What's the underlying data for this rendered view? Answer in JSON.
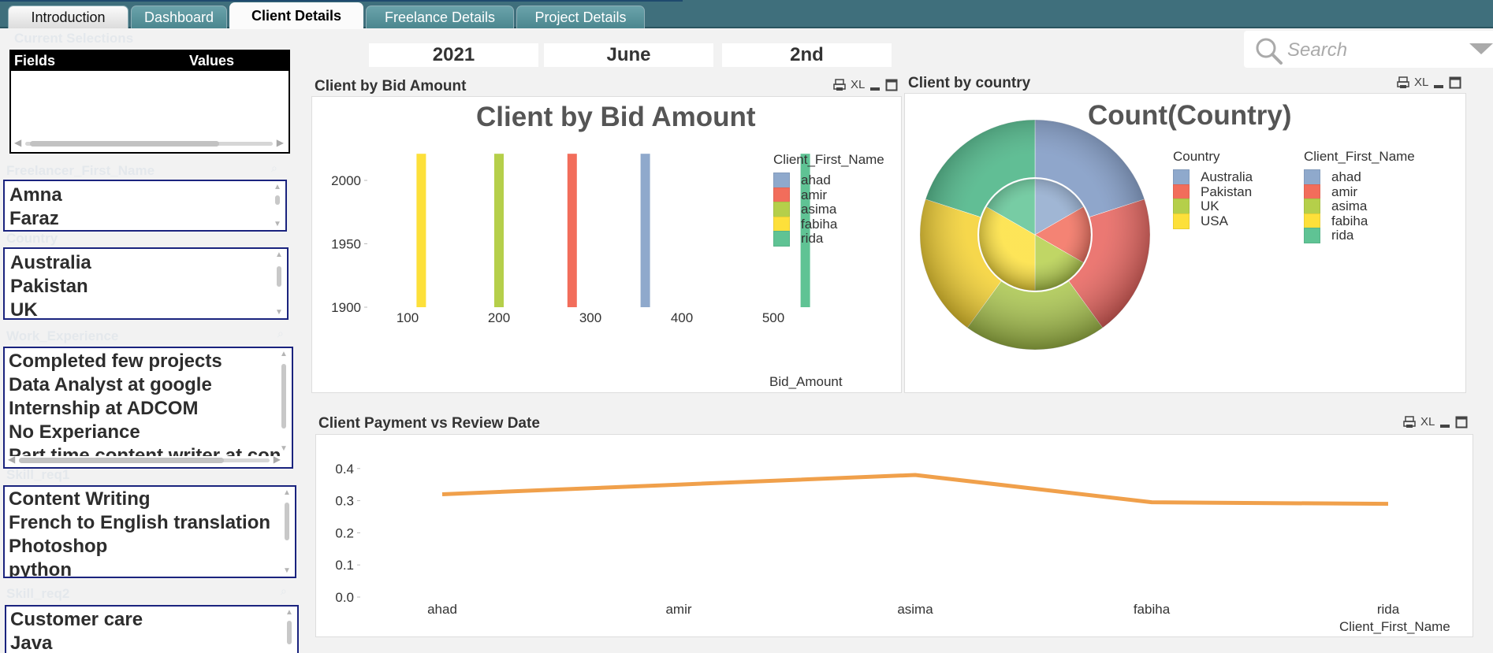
{
  "tabs": [
    {
      "label": "Introduction",
      "state": "plain"
    },
    {
      "label": "Dashboard",
      "state": "teal"
    },
    {
      "label": "Client Details",
      "state": "active"
    },
    {
      "label": "Freelance Details",
      "state": "teal"
    },
    {
      "label": "Project Details",
      "state": "teal"
    }
  ],
  "current_selections": {
    "caption": "Current Selections",
    "col_fields": "Fields",
    "col_values": "Values"
  },
  "listboxes": [
    {
      "caption": "Freelancer_First_Name",
      "items": [
        "Amna",
        "Faraz"
      ]
    },
    {
      "caption": "Country",
      "items": [
        "Australia",
        "Pakistan",
        "UK"
      ]
    },
    {
      "caption": "Work_Experience",
      "items": [
        "Completed few projects",
        "Data Analyst at google",
        "Internship at ADCOM",
        "No Experiance",
        "Part time content writer at con"
      ]
    },
    {
      "caption": "Skill_req1",
      "items": [
        "Content Writing",
        "French to English translation",
        "Photoshop",
        "python"
      ]
    },
    {
      "caption": "Skill_req2",
      "items": [
        "Customer care",
        "Java"
      ]
    }
  ],
  "date_filters": {
    "year": "2021",
    "month": "June",
    "day": "2nd"
  },
  "search": {
    "placeholder": "Search"
  },
  "bid_chart": {
    "panel_title": "Client by Bid Amount",
    "tools": {
      "xl": "XL"
    },
    "chart_data": {
      "type": "bar",
      "title": "Client by Bid Amount",
      "xlabel": "Bid_Amount",
      "ylabel": "",
      "xticks": [
        100,
        200,
        300,
        400,
        500
      ],
      "yticks": [
        1900,
        1950,
        2000
      ],
      "legend_title": "Client_First_Name",
      "legend_position": "right",
      "series": [
        {
          "name": "ahad",
          "x": 360,
          "y": 2021,
          "color": "#8fa9cc"
        },
        {
          "name": "amir",
          "x": 280,
          "y": 2021,
          "color": "#f26d5b"
        },
        {
          "name": "asima",
          "x": 200,
          "y": 2021,
          "color": "#b5cf4a"
        },
        {
          "name": "fabiha",
          "x": 115,
          "y": 2021,
          "color": "#fde03a"
        },
        {
          "name": "rida",
          "x": 535,
          "y": 2021,
          "color": "#5fc394"
        }
      ]
    }
  },
  "country_chart": {
    "panel_title": "Client by country",
    "tools": {
      "xl": "XL"
    },
    "chart_data": {
      "type": "pie",
      "title": "Count(Country)",
      "outer_legend_title": "Country",
      "inner_legend_title": "Client_First_Name",
      "outer": [
        {
          "label": "Australia",
          "value": 1,
          "color": "#7b96c2"
        },
        {
          "label": "Pakistan",
          "value": 1,
          "color": "#e8605a"
        },
        {
          "label": "UK",
          "value": 1,
          "color": "#a8c44a"
        },
        {
          "label": "USA",
          "value": 1,
          "color": "#f4d02c"
        },
        {
          "label": "",
          "value": 1,
          "color": "#45b282"
        }
      ],
      "inner": [
        {
          "label": "ahad",
          "value": 1,
          "color": "#8fa9cc"
        },
        {
          "label": "amir",
          "value": 1,
          "color": "#f26d5b"
        },
        {
          "label": "asima",
          "value": 1,
          "color": "#b5cf4a"
        },
        {
          "label": "fabiha",
          "value": 2,
          "color": "#fde03a"
        },
        {
          "label": "rida",
          "value": 1,
          "color": "#5fc394"
        }
      ],
      "legend_countries": [
        {
          "label": "Australia",
          "color": "#8fa9cc"
        },
        {
          "label": "Pakistan",
          "color": "#f26d5b"
        },
        {
          "label": "UK",
          "color": "#b5cf4a"
        },
        {
          "label": "USA",
          "color": "#fde03a"
        }
      ],
      "legend_names": [
        {
          "label": "ahad",
          "color": "#8fa9cc"
        },
        {
          "label": "amir",
          "color": "#f26d5b"
        },
        {
          "label": "asima",
          "color": "#b5cf4a"
        },
        {
          "label": "fabiha",
          "color": "#fde03a"
        },
        {
          "label": "rida",
          "color": "#5fc394"
        }
      ]
    }
  },
  "payment_chart": {
    "panel_title": "Client Payment vs Review Date",
    "tools": {
      "xl": "XL"
    },
    "chart_data": {
      "type": "line",
      "xlabel": "Client_First_Name",
      "ylabel": "",
      "categories": [
        "ahad",
        "amir",
        "asima",
        "fabiha",
        "rida"
      ],
      "yticks": [
        0.0,
        0.1,
        0.2,
        0.3,
        0.4
      ],
      "ylim": [
        0,
        0.4
      ],
      "series": [
        {
          "values": [
            0.32,
            0.35,
            0.38,
            0.295,
            0.29
          ],
          "color": "#f0a04b"
        }
      ]
    }
  }
}
